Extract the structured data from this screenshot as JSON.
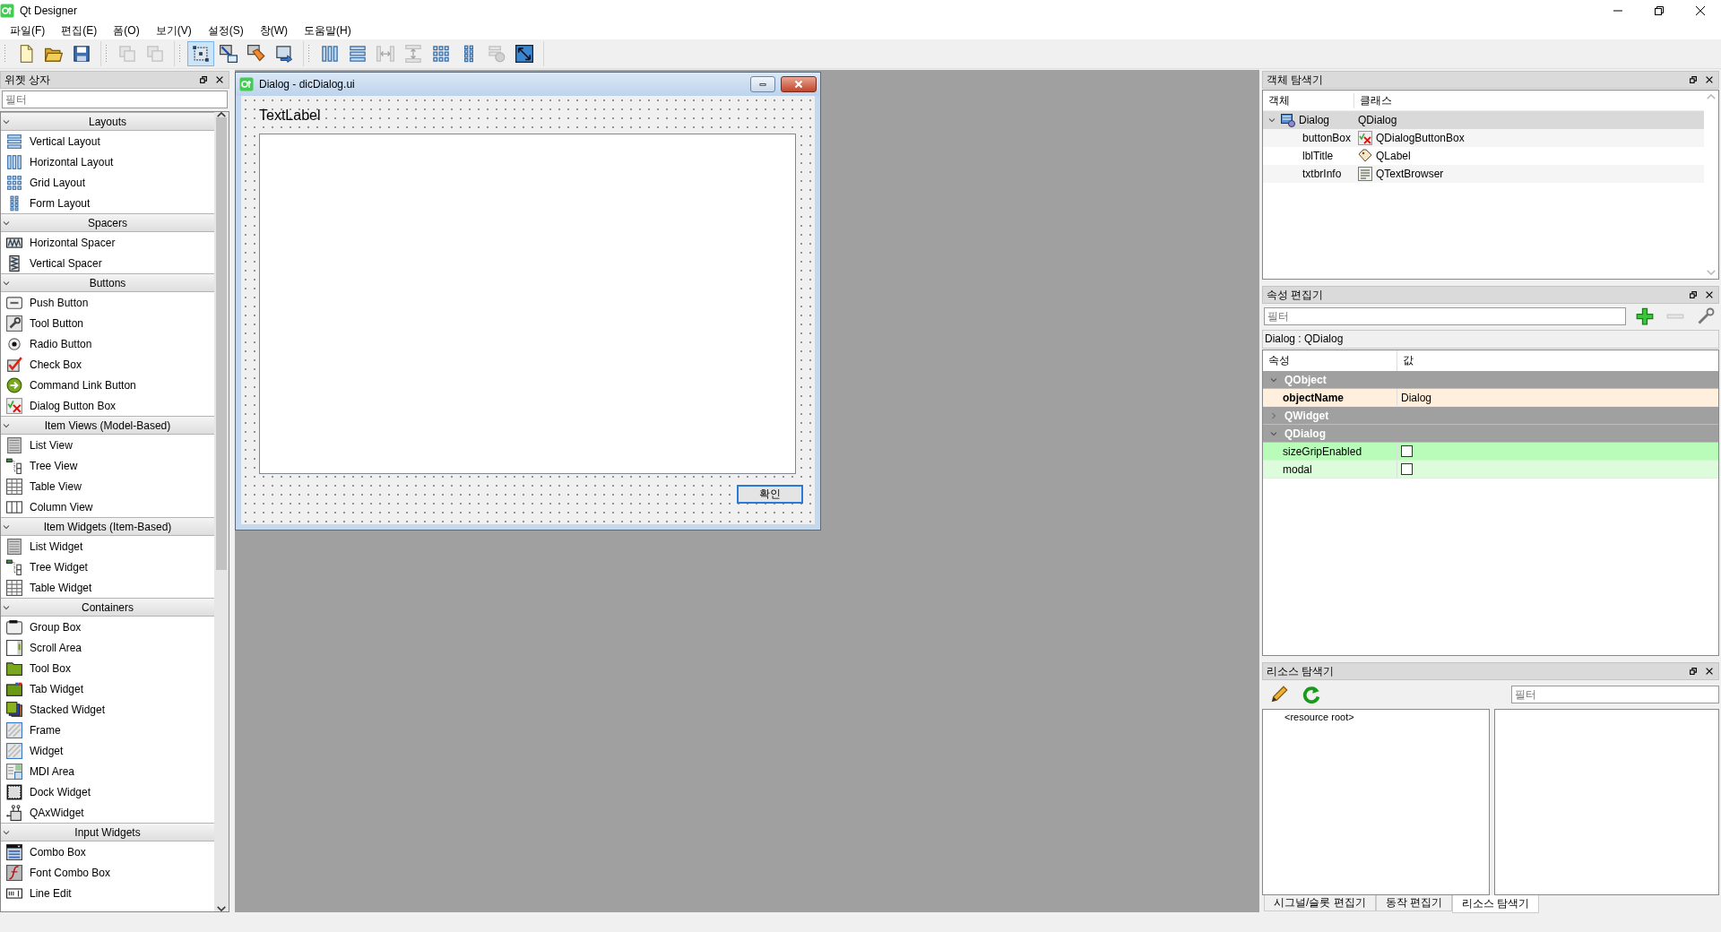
{
  "window": {
    "title": "Qt Designer"
  },
  "menu": [
    "파일(F)",
    "편집(E)",
    "폼(O)",
    "보기(V)",
    "설정(S)",
    "창(W)",
    "도움말(H)"
  ],
  "toolbar": [
    [
      {
        "selected": false,
        "disabled": false
      },
      {
        "selected": false,
        "disabled": false
      },
      {
        "selected": false,
        "disabled": false
      }
    ],
    [
      {
        "selected": false,
        "disabled": true
      },
      {
        "selected": false,
        "disabled": true
      }
    ],
    [
      {
        "selected": true,
        "disabled": false
      },
      {
        "selected": false,
        "disabled": false
      },
      {
        "selected": false,
        "disabled": false
      },
      {
        "selected": false,
        "disabled": false
      }
    ],
    [
      {
        "selected": false,
        "disabled": false
      },
      {
        "selected": false,
        "disabled": false
      },
      {
        "selected": false,
        "disabled": true
      },
      {
        "selected": false,
        "disabled": true
      },
      {
        "selected": false,
        "disabled": false
      },
      {
        "selected": false,
        "disabled": false
      },
      {
        "selected": false,
        "disabled": true
      },
      {
        "selected": false,
        "disabled": false
      }
    ]
  ],
  "widget_box": {
    "title": "위젯 상자",
    "filter": {
      "placeholder": "필터"
    },
    "sections": [
      {
        "name": "Layouts",
        "expanded": true,
        "items": [
          "Vertical Layout",
          "Horizontal Layout",
          "Grid Layout",
          "Form Layout"
        ]
      },
      {
        "name": "Spacers",
        "expanded": true,
        "items": [
          "Horizontal Spacer",
          "Vertical Spacer"
        ]
      },
      {
        "name": "Buttons",
        "expanded": true,
        "items": [
          "Push Button",
          "Tool Button",
          "Radio Button",
          "Check Box",
          "Command Link Button",
          "Dialog Button Box"
        ]
      },
      {
        "name": "Item Views (Model-Based)",
        "expanded": true,
        "items": [
          "List View",
          "Tree View",
          "Table View",
          "Column View"
        ]
      },
      {
        "name": "Item Widgets (Item-Based)",
        "expanded": true,
        "items": [
          "List Widget",
          "Tree Widget",
          "Table Widget"
        ]
      },
      {
        "name": "Containers",
        "expanded": true,
        "items": [
          "Group Box",
          "Scroll Area",
          "Tool Box",
          "Tab Widget",
          "Stacked Widget",
          "Frame",
          "Widget",
          "MDI Area",
          "Dock Widget",
          "QAxWidget"
        ]
      },
      {
        "name": "Input Widgets",
        "expanded": true,
        "items": [
          "Combo Box",
          "Font Combo Box",
          "Line Edit"
        ]
      }
    ]
  },
  "form_window": {
    "title": "Dialog - dicDialog.ui",
    "label": "TextLabel",
    "button": "확인"
  },
  "object_inspector": {
    "title": "객체 탐색기",
    "columns": [
      "객체",
      "클래스"
    ],
    "rows": [
      {
        "object": "Dialog",
        "class": "QDialog",
        "expanded": true,
        "selected": true,
        "children": [
          {
            "object": "buttonBox",
            "class": "QDialogButtonBox",
            "selected": false
          },
          {
            "object": "lblTitle",
            "class": "QLabel",
            "selected": false
          },
          {
            "object": "txtbrInfo",
            "class": "QTextBrowser",
            "selected": false
          }
        ]
      }
    ]
  },
  "property_editor": {
    "title": "속성 편집기",
    "filter": {
      "placeholder": "필터"
    },
    "tool_buttons": [
      {
        "disabled": false
      },
      {
        "disabled": true
      },
      {
        "disabled": false
      }
    ],
    "object_label": "Dialog : QDialog",
    "columns": [
      "속성",
      "값"
    ],
    "groups": [
      {
        "name": "QObject",
        "expanded": true,
        "properties": [
          {
            "name": "objectName",
            "kind": "text",
            "value": "Dialog",
            "modified": true,
            "color": "#ffefdc"
          }
        ]
      },
      {
        "name": "QWidget",
        "expanded": false
      },
      {
        "name": "QDialog",
        "expanded": true,
        "properties": [
          {
            "name": "sizeGripEnabled",
            "kind": "checkbox",
            "checked": false,
            "modified": false,
            "color": "#b9fbb9"
          },
          {
            "name": "modal",
            "kind": "checkbox",
            "checked": false,
            "modified": false,
            "color": "#dcfcdc"
          }
        ]
      }
    ]
  },
  "resource_browser": {
    "title": "리소스 탐색기",
    "filter": {
      "placeholder": "필터"
    },
    "tree": [
      "<resource root>"
    ]
  },
  "bottom_tabs": [
    {
      "label": "시그널/슬롯 편집기",
      "selected": false
    },
    {
      "label": "동작 편집기",
      "selected": false
    },
    {
      "label": "리소스 탐색기",
      "selected": true
    }
  ]
}
